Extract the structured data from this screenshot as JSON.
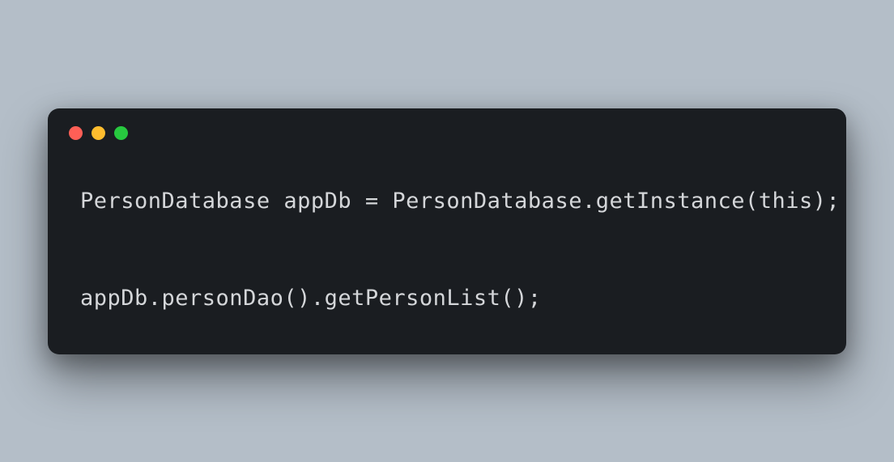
{
  "window": {
    "controls": {
      "close": "close",
      "minimize": "minimize",
      "maximize": "maximize"
    }
  },
  "code": {
    "line1": "PersonDatabase appDb = PersonDatabase.getInstance(this);",
    "line2": "appDb.personDao().getPersonList();"
  }
}
